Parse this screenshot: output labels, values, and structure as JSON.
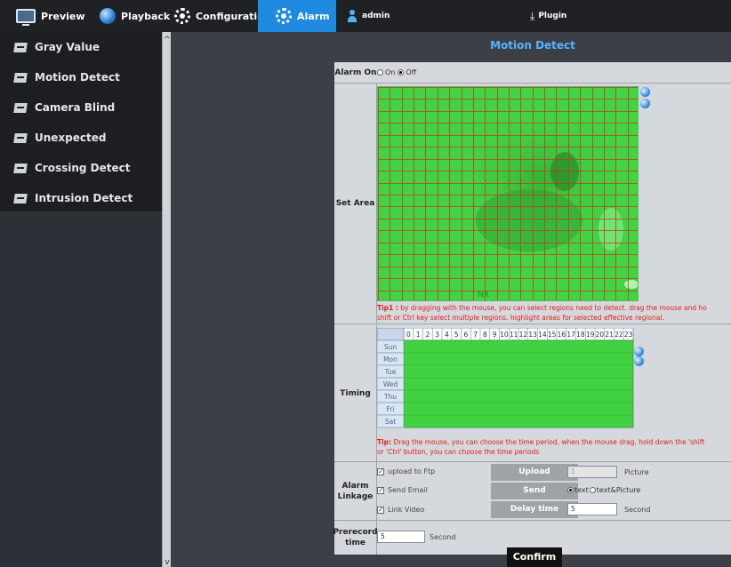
{
  "nav": {
    "preview": "Preview",
    "playback": "Playback",
    "configuration": "Configuration",
    "alarm": "Alarm",
    "user": "admin",
    "plugin": "Plugin"
  },
  "sidebar": {
    "items": [
      {
        "label": "Gray Value"
      },
      {
        "label": "Motion Detect"
      },
      {
        "label": "Camera Blind"
      },
      {
        "label": "Unexpected"
      },
      {
        "label": "Crossing Detect"
      },
      {
        "label": "Intrusion Detect"
      }
    ]
  },
  "panel": {
    "title": "Motion Detect",
    "alarm_on": {
      "label": "Alarm On",
      "on": "On",
      "off": "Off",
      "selected": "Off"
    },
    "set_area": {
      "label": "Set Area",
      "tip_prefix": "Tip1 :",
      "tip_line1": " by dragging with the mouse, you can select regions need to detect. drag the mouse and ho",
      "tip_line2": "shift or Ctrl key select multiple regions. highlight areas for selected effective regional.",
      "overlay_text": "NX"
    },
    "timing": {
      "label": "Timing",
      "days": [
        "Sun",
        "Mon",
        "Tue",
        "Wed",
        "Thu",
        "Fri",
        "Sat"
      ],
      "hours": [
        "0",
        "1",
        "2",
        "3",
        "4",
        "5",
        "6",
        "7",
        "8",
        "9",
        "10",
        "11",
        "12",
        "13",
        "14",
        "15",
        "16",
        "17",
        "18",
        "19",
        "20",
        "21",
        "22",
        "23"
      ],
      "tip_prefix": "Tip:",
      "tip_line1": " Drag the mouse, you can choose the time period, when the mouse drag, hold down the 'shift",
      "tip_line2": "or 'Ctrl' button, you can choose the time periods"
    },
    "linkage": {
      "label_line1": "Alarm",
      "label_line2": "Linkage",
      "options": [
        {
          "label": "upload to Ftp",
          "checked": true
        },
        {
          "label": "Send Email",
          "checked": true
        },
        {
          "label": "Link Video",
          "checked": true
        }
      ],
      "upload": {
        "label": "Upload",
        "value": "1",
        "unit": "Picture"
      },
      "send": {
        "label": "Send",
        "opt1": "text",
        "opt2": "text&Picture",
        "selected": "text"
      },
      "delay": {
        "label": "Delay time",
        "value": "5",
        "unit": "Second"
      }
    },
    "prerecord": {
      "label_line1": "Prerecord",
      "label_line2": "time",
      "value": "5",
      "unit": "Second"
    },
    "confirm": "Confirm"
  },
  "colors": {
    "accent": "#1f8ae0",
    "title": "#59b3ff",
    "grid_fill": "#41d241",
    "grid_line": "#c0392b",
    "tip": "#e02020"
  }
}
